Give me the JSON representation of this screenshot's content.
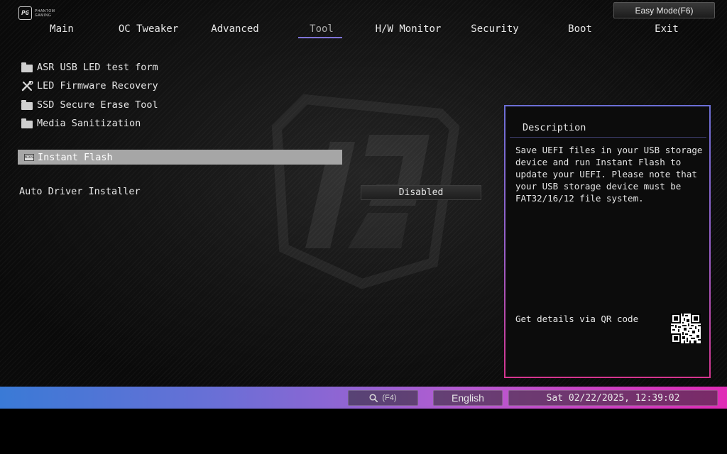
{
  "header": {
    "logo_text_line1": "PHANTOM",
    "logo_text_line2": "GAMING",
    "easy_mode_label": "Easy Mode(F6)"
  },
  "nav": {
    "tabs": [
      "Main",
      "OC Tweaker",
      "Advanced",
      "Tool",
      "H/W Monitor",
      "Security",
      "Boot",
      "Exit"
    ],
    "active": "Tool"
  },
  "tool_menu": {
    "items": [
      {
        "label": "ASR USB LED test form",
        "icon": "folder-icon"
      },
      {
        "label": "LED Firmware Recovery",
        "icon": "tools-icon"
      },
      {
        "label": "SSD Secure Erase Tool",
        "icon": "folder-icon"
      },
      {
        "label": "Media Sanitization",
        "icon": "folder-icon"
      }
    ],
    "selected": {
      "label": "Instant Flash",
      "icon": "bios-chip-icon",
      "icon_text": "BIOS"
    },
    "settings": [
      {
        "label": "Auto Driver Installer",
        "value": "Disabled"
      }
    ]
  },
  "description": {
    "title": "Description",
    "text": "Save UEFI files in your USB storage\ndevice and run Instant Flash to\nupdate your UEFI. Please note that\nyour USB storage device must be\nFAT32/16/12 file system.",
    "qr_label": "Get details via QR code"
  },
  "status_bar": {
    "search_label": "(F4)",
    "language": "English",
    "datetime": "Sat 02/22/2025, 12:39:02"
  },
  "colors": {
    "accent_underline": "#7f74d8",
    "bar_gradient_start": "#3a7ad6",
    "bar_gradient_end": "#e02cb6",
    "selected_row": "#a6a6a6"
  }
}
